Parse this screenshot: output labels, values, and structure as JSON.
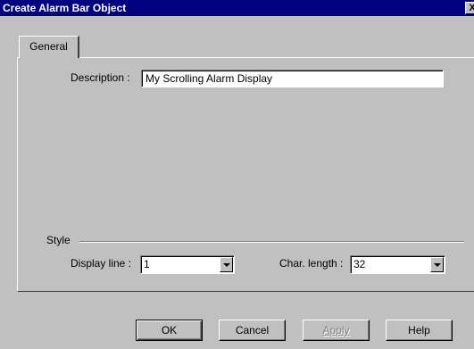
{
  "window": {
    "title": "Create Alarm Bar Object",
    "close_glyph": "X"
  },
  "tabs": [
    {
      "label": "General"
    }
  ],
  "general": {
    "description_label": "Description :",
    "description_value": "My Scrolling Alarm Display",
    "style_group_label": "Style",
    "display_line_label": "Display line :",
    "display_line_value": "1",
    "char_length_label": "Char. length :",
    "char_length_value": "32"
  },
  "buttons": {
    "ok": "OK",
    "cancel": "Cancel",
    "apply": "Apply",
    "help": "Help"
  }
}
